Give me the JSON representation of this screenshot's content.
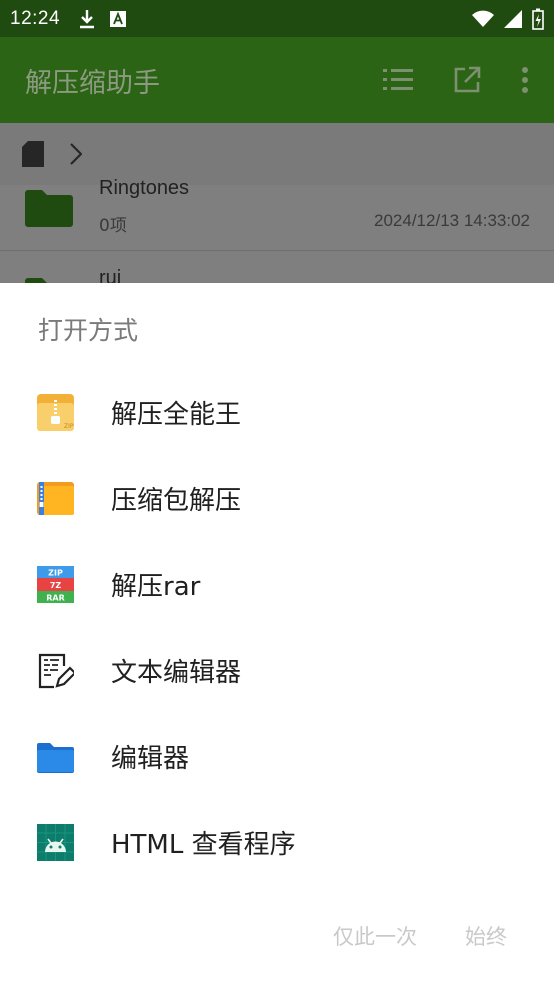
{
  "status_bar": {
    "time": "12:24",
    "icons": [
      "download-icon",
      "font-a-icon",
      "wifi-icon",
      "signal-icon",
      "battery-icon"
    ]
  },
  "app_bar": {
    "title": "解压缩助手",
    "actions": [
      "list-view-icon",
      "open-external-icon",
      "more-vert-icon"
    ],
    "bg_color": "#2b6414"
  },
  "breadcrumb": {
    "icons": [
      "sd-card-icon",
      "chevron-right-icon"
    ]
  },
  "files": [
    {
      "name": "Ringtones",
      "count": "0项",
      "date": "2024/12/13 14:33:02"
    },
    {
      "name": "rui",
      "count": "",
      "date": ""
    }
  ],
  "sheet": {
    "title": "打开方式",
    "options": [
      {
        "label": "解压全能王",
        "icon": "zip-folder-icon"
      },
      {
        "label": "压缩包解压",
        "icon": "archive-folder-icon"
      },
      {
        "label": "解压rar",
        "icon": "zip-7z-rar-icon"
      },
      {
        "label": "文本编辑器",
        "icon": "text-editor-icon"
      },
      {
        "label": "编辑器",
        "icon": "blue-folder-icon"
      },
      {
        "label": "HTML 查看程序",
        "icon": "android-html-icon"
      }
    ],
    "buttons": {
      "once": "仅此一次",
      "always": "始终"
    }
  },
  "zip_icon_lines": [
    "ZIP",
    "7Z",
    "RAR"
  ],
  "zip_badge": "ZIP"
}
